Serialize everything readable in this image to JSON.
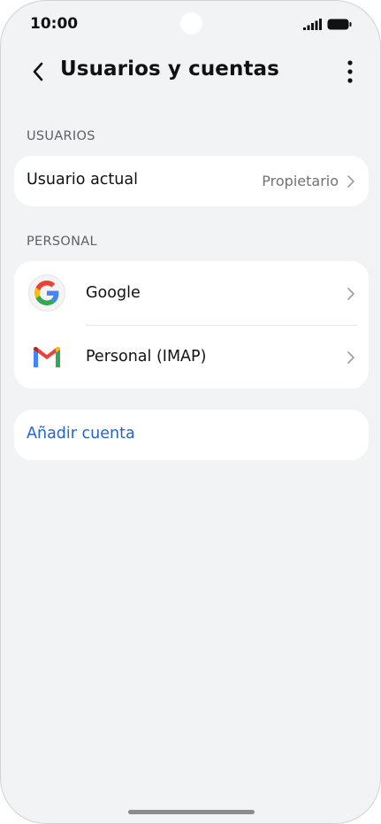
{
  "status_bar": {
    "time": "10:00"
  },
  "app_bar": {
    "title": "Usuarios y cuentas"
  },
  "users_section": {
    "header": "USUARIOS",
    "current_user": {
      "label": "Usuario actual",
      "value": "Propietario"
    }
  },
  "personal_section": {
    "header": "PERSONAL",
    "accounts": [
      {
        "label": "Google",
        "icon": "google-icon"
      },
      {
        "label": "Personal (IMAP)",
        "icon": "gmail-icon"
      }
    ]
  },
  "add_account": {
    "label": "Añadir cuenta"
  },
  "colors": {
    "background": "#f2f3f5",
    "card": "#ffffff",
    "link": "#2264d6",
    "google_blue": "#4285F4",
    "google_red": "#EA4335",
    "google_yellow": "#FBBC05",
    "google_green": "#34A853"
  }
}
